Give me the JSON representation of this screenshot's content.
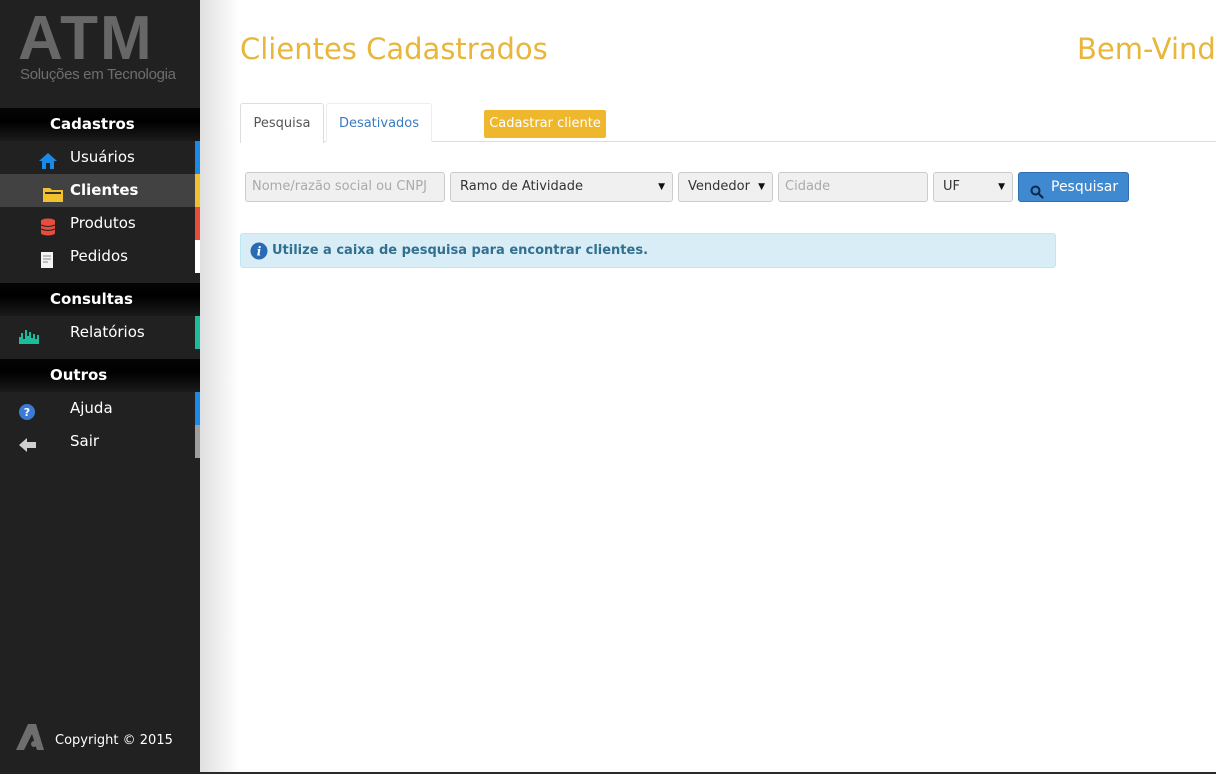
{
  "brand": {
    "logo_text": "ATM",
    "tagline": "Soluções em Tecnologia"
  },
  "sidebar": {
    "sections": [
      {
        "title": "Cadastros",
        "items": [
          {
            "label": "Usuários",
            "icon": "home-icon",
            "stripe": "#1a8ae6"
          },
          {
            "label": "Clientes",
            "icon": "folder-icon",
            "stripe": "#f2c12e",
            "active": true
          },
          {
            "label": "Produtos",
            "icon": "database-icon",
            "stripe": "#e84c3d"
          },
          {
            "label": "Pedidos",
            "icon": "document-icon",
            "stripe": "#ffffff"
          }
        ]
      },
      {
        "title": "Consultas",
        "items": [
          {
            "label": "Relatórios",
            "icon": "bar-chart-icon",
            "stripe": "#1abc9c"
          }
        ]
      },
      {
        "title": "Outros",
        "items": [
          {
            "label": "Ajuda",
            "icon": "help-icon",
            "stripe": "#1a8ae6"
          },
          {
            "label": "Sair",
            "icon": "arrow-left-icon",
            "stripe": "#9e9e9e"
          }
        ]
      }
    ],
    "copyright": "Copyright © 2015"
  },
  "header": {
    "title": "Clientes Cadastrados",
    "welcome": "Bem-Vind"
  },
  "tabs": [
    {
      "label": "Pesquisa",
      "active": true
    },
    {
      "label": "Desativados",
      "active": false
    }
  ],
  "actions": {
    "add_client": "Cadastrar cliente"
  },
  "search": {
    "name_placeholder": "Nome/razão social ou CNPJ",
    "activity_selected": "Ramo de Atividade",
    "seller_selected": "Vendedor",
    "city_placeholder": "Cidade",
    "uf_selected": "UF",
    "button_label": "Pesquisar"
  },
  "alert": {
    "message": "Utilize a caixa de pesquisa para encontrar clientes."
  },
  "colors": {
    "accent": "#e8b63a",
    "primary_button": "#3f89d0",
    "sidebar_bg": "#212121",
    "info_bg": "#d9edf7"
  }
}
